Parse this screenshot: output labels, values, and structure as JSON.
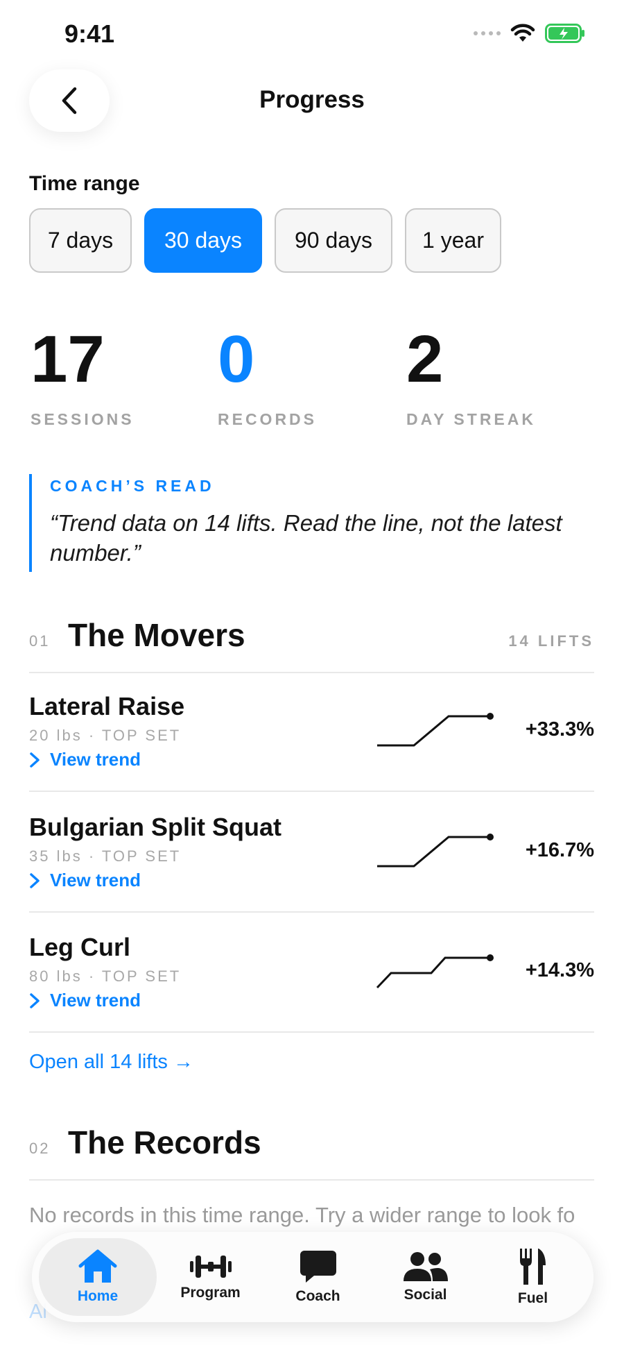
{
  "status_bar": {
    "time": "9:41"
  },
  "header": {
    "title": "Progress"
  },
  "time_range": {
    "label": "Time range",
    "options": [
      "7 days",
      "30 days",
      "90 days",
      "1 year"
    ],
    "selected": "30 days"
  },
  "stats": [
    {
      "value": "17",
      "label": "SESSIONS"
    },
    {
      "value": "0",
      "label": "RECORDS"
    },
    {
      "value": "2",
      "label": "DAY STREAK"
    }
  ],
  "coach": {
    "label": "COACH’S READ",
    "quote": "“Trend data on 14 lifts. Read the line, not the latest number.”"
  },
  "movers": {
    "number": "01",
    "title": "The Movers",
    "count": "14 LIFTS",
    "items": [
      {
        "name": "Lateral Raise",
        "detail": "20 lbs · TOP SET",
        "link": "View trend",
        "change": "+33.3%"
      },
      {
        "name": "Bulgarian Split Squat",
        "detail": "35 lbs · TOP SET",
        "link": "View trend",
        "change": "+16.7%"
      },
      {
        "name": "Leg Curl",
        "detail": "80 lbs · TOP SET",
        "link": "View trend",
        "change": "+14.3%"
      }
    ],
    "open_all": "Open all 14 lifts →"
  },
  "records": {
    "number": "02",
    "title": "The Records",
    "empty_text": "No records in this time range. Try a wider range to look fo",
    "link": "Al"
  },
  "tab_bar": {
    "tabs": [
      {
        "label": "Home",
        "icon": "home-icon",
        "active": true
      },
      {
        "label": "Program",
        "icon": "dumbbell-icon",
        "active": false
      },
      {
        "label": "Coach",
        "icon": "chat-bubble-icon",
        "active": false
      },
      {
        "label": "Social",
        "icon": "people-icon",
        "active": false
      },
      {
        "label": "Fuel",
        "icon": "fork-knife-icon",
        "active": false
      }
    ]
  },
  "colors": {
    "accent": "#0a84ff",
    "muted": "#a3a3a3",
    "battery": "#34c759"
  }
}
